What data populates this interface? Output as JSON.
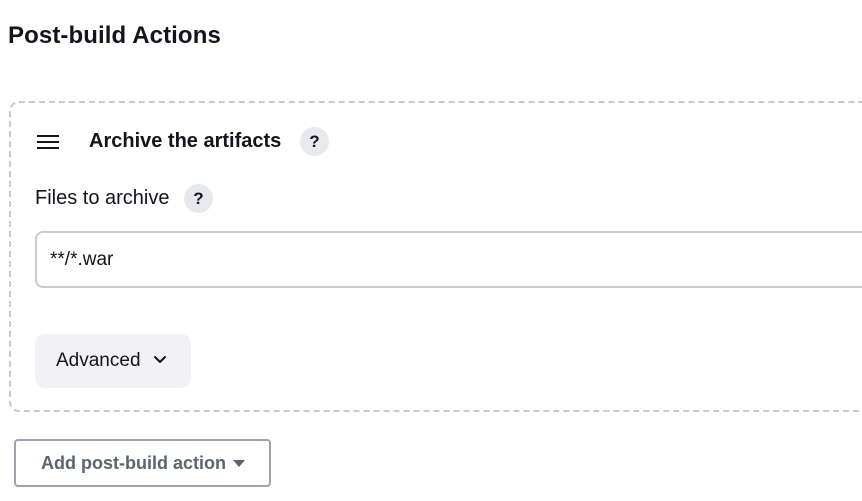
{
  "section": {
    "title": "Post-build Actions"
  },
  "step": {
    "title": "Archive the artifacts",
    "help_label": "?",
    "files_field": {
      "label": "Files to archive",
      "help_label": "?",
      "value": "**/*.war"
    },
    "advanced_label": "Advanced"
  },
  "add_action_label": "Add post-build action",
  "icons": {
    "drag_handle": "hamburger-icon",
    "advanced_chevron": "chevron-down-icon",
    "add_caret": "caret-down-icon"
  }
}
